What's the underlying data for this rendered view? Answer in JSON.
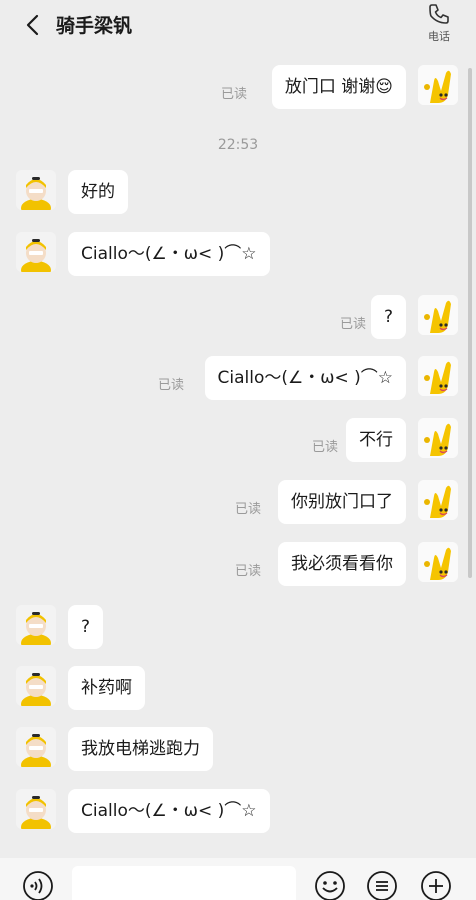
{
  "header": {
    "title": "骑手梁钒",
    "call_label": "电话"
  },
  "read_label": "已读",
  "time": "22:53",
  "messages": [
    {
      "side": "right",
      "text": "放门口 谢谢😌"
    },
    {
      "side": "left",
      "text": "好的"
    },
    {
      "side": "left",
      "text": "Ciallo～(∠・ω< )⌒☆"
    },
    {
      "side": "right",
      "text": "?"
    },
    {
      "side": "right",
      "text": "Ciallo～(∠・ω< )⌒☆"
    },
    {
      "side": "right",
      "text": "不行"
    },
    {
      "side": "right",
      "text": "你别放门口了"
    },
    {
      "side": "right",
      "text": "我必须看看你"
    },
    {
      "side": "left",
      "text": "?"
    },
    {
      "side": "left",
      "text": "补药啊"
    },
    {
      "side": "left",
      "text": "我放电梯逃跑力"
    },
    {
      "side": "left",
      "text": "Ciallo～(∠・ω< )⌒☆"
    }
  ],
  "input": {
    "placeholder": ""
  },
  "colors": {
    "background": "#ededed",
    "bubble": "#ffffff",
    "read_text": "#9a9a9a",
    "accent_yellow": "#f5c400"
  }
}
